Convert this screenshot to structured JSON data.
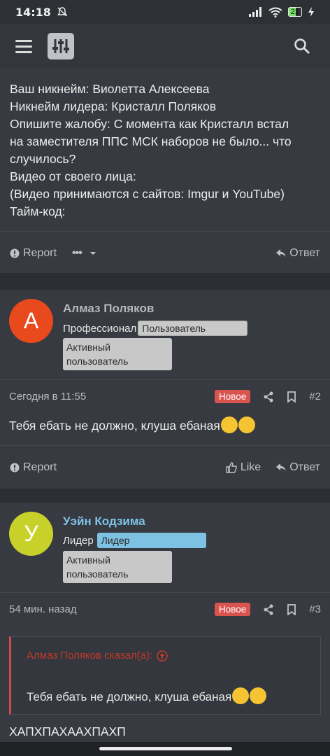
{
  "status_bar": {
    "time": "14:18",
    "battery": "21"
  },
  "post1": {
    "lines": [
      "Ваш никнейм: Виолетта Алексеева",
      "Никнейм лидера: Кристалл Поляков",
      "Опишите жалобу: С момента как Кристалл встал",
      "на заместителя ППС МСК наборов не было... что",
      "случилось?",
      "Видео от своего лица:",
      "(Видео принимаются с сайтов: Imgur и YouTube)",
      "Тайм-код:"
    ],
    "report_label": "Report",
    "more_label": "•••",
    "reply_label": "Ответ"
  },
  "post2": {
    "avatar_letter": "А",
    "author": "Алмаз Поляков",
    "title": "Профессионал",
    "role_badge": "Пользователь",
    "active_line1": "Активный",
    "active_line2": "пользователь",
    "time": "Сегодня в 11:55",
    "new_badge": "Новое",
    "number": "#2",
    "text": "Тебя ебать не должно, клуша ебаная",
    "report_label": "Report",
    "like_label": "Like",
    "reply_label": "Ответ"
  },
  "post3": {
    "avatar_letter": "У",
    "author": "Уэйн Кодзима",
    "title": "Лидер",
    "role_badge": "Лидер",
    "active_line1": "Активный",
    "active_line2": "пользователь",
    "time": "54 мин. назад",
    "new_badge": "Новое",
    "number": "#3",
    "quote_author": "Алмаз Поляков сказал(а):",
    "quote_text": "Тебя ебать не должно, клуша ебаная",
    "text": "ХАПХПАХААХПАХП"
  },
  "colors": {
    "avatar2": "#e8491d",
    "avatar3": "#c8d12a",
    "leader_name": "#7fc4e6",
    "leader_badge": "#7ec2e3",
    "new_badge": "#d9534f",
    "quote_accent": "#c0392b"
  }
}
